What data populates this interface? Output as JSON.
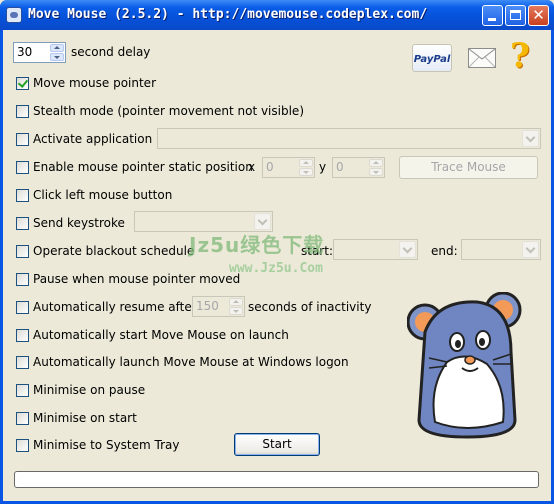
{
  "window": {
    "title": "Move Mouse (2.5.2) - http://movemouse.codeplex.com/",
    "close_glyph": "✕"
  },
  "delay": {
    "value": "30",
    "label": "second delay"
  },
  "options": {
    "move_pointer": "Move mouse pointer",
    "stealth": "Stealth mode (pointer movement not visible)",
    "activate_app": "Activate application",
    "static_pos": "Enable mouse pointer static position",
    "x_label": "x",
    "x_value": "0",
    "y_label": "y",
    "y_value": "0",
    "trace_mouse": "Trace Mouse",
    "click_left": "Click left mouse button",
    "send_keystroke": "Send keystroke",
    "blackout": "Operate blackout schedule",
    "blackout_start_label": "start:",
    "blackout_end_label": "end:",
    "pause_moved": "Pause when mouse pointer moved",
    "auto_resume": "Automatically resume after",
    "resume_value": "150",
    "resume_suffix": "seconds of inactivity",
    "auto_start": "Automatically start Move Mouse on launch",
    "auto_launch": "Automatically launch Move Mouse at Windows logon",
    "min_pause": "Minimise on pause",
    "min_start": "Minimise on start",
    "min_tray": "Minimise to System Tray"
  },
  "start_button": "Start",
  "paypal_label": "PayPal",
  "help_glyph": "?",
  "watermark": {
    "line1": "Jz5u绿色下载",
    "line2": "www.Jz5u.Com"
  },
  "checked": {
    "move_pointer": true
  },
  "icons": [
    "paypal-icon",
    "email-icon",
    "help-icon",
    "mouse-mascot-icon"
  ]
}
